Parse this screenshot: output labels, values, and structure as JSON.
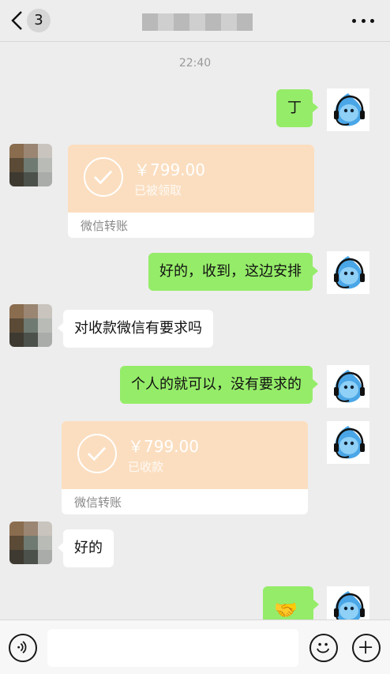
{
  "header": {
    "back_icon": "chevron-left-icon",
    "unread_count": "3",
    "more_icon": "more-dots-icon"
  },
  "chat": {
    "timestamp": "22:40",
    "messages": [
      {
        "from": "me",
        "type": "text",
        "text": "丁"
      },
      {
        "from": "other",
        "type": "transfer",
        "amount": "￥799.00",
        "status": "已被领取",
        "footer": "微信转账"
      },
      {
        "from": "me",
        "type": "text",
        "text": "好的，收到，这边安排"
      },
      {
        "from": "other",
        "type": "text",
        "text": "对收款微信有要求吗"
      },
      {
        "from": "me",
        "type": "text",
        "text": "个人的就可以，没有要求的"
      },
      {
        "from": "me",
        "type": "transfer",
        "amount": "￥799.00",
        "status": "已收款",
        "footer": "微信转账"
      },
      {
        "from": "other",
        "type": "text",
        "text": "好的"
      },
      {
        "from": "me",
        "type": "emoji",
        "icon": "handshake-icon"
      }
    ]
  },
  "colors": {
    "my_bubble": "#95ec69",
    "other_bubble": "#ffffff",
    "transfer": "#fbdec0",
    "background": "#ededed"
  },
  "input_bar": {
    "voice_icon": "voice-icon",
    "emoji_icon": "smiley-icon",
    "plus_icon": "plus-icon"
  }
}
